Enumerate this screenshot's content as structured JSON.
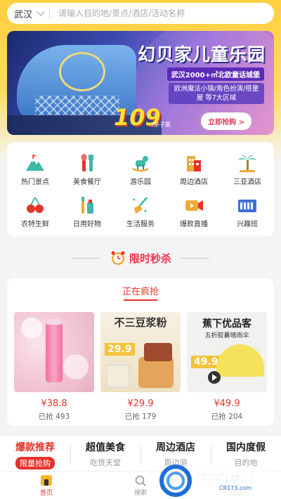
{
  "search": {
    "city": "武汉",
    "placeholder": "请输入目的地/景点/酒店/活动名称"
  },
  "banner": {
    "title": "幻贝家儿童乐园",
    "sub1": "武汉2000+㎡北欧童话城堡",
    "sub2": "欧洲魔法小镇/角色扮演/搭童屋 等7大区域",
    "price": "109",
    "unit": "/亲子票",
    "button": "立即抢购 >"
  },
  "categories": [
    {
      "label": "热门景点",
      "icon": "mountain-icon"
    },
    {
      "label": "美食餐厅",
      "icon": "cutlery-icon"
    },
    {
      "label": "游乐园",
      "icon": "rocking-horse-icon"
    },
    {
      "label": "周边酒店",
      "icon": "hotel-icon"
    },
    {
      "label": "三亚酒店",
      "icon": "palm-tree-icon"
    },
    {
      "label": "农特生鲜",
      "icon": "cherry-icon"
    },
    {
      "label": "日用好物",
      "icon": "toothbrush-icon"
    },
    {
      "label": "生活服务",
      "icon": "broom-icon"
    },
    {
      "label": "爆款直播",
      "icon": "video-camera-icon"
    },
    {
      "label": "兴趣班",
      "icon": "keyboard-icon"
    }
  ],
  "flash": {
    "title": "限时秒杀",
    "active_tab": "正在疯抢",
    "products": [
      {
        "price": "¥38.8",
        "sold": "已抢 493",
        "name": "pink-lotion"
      },
      {
        "price": "¥29.9",
        "sold": "已抢 179",
        "name": "soy-milk",
        "img_text": "不三豆浆粉",
        "img_price": "29.9"
      },
      {
        "price": "¥49.9",
        "sold": "已抢 204",
        "name": "umbrella",
        "img_text1": "蕉下优品客",
        "img_text2": "五折胶囊晴雨伞",
        "img_price": "49.9"
      }
    ]
  },
  "tabs": [
    {
      "title": "爆款推荐",
      "sub": "限量抢购"
    },
    {
      "title": "超值美食",
      "sub": "吃货天堂"
    },
    {
      "title": "周边酒店",
      "sub": "周边游"
    },
    {
      "title": "国内度假",
      "sub": "目的地"
    }
  ],
  "nav": [
    {
      "label": "首页",
      "icon": "home-icon"
    },
    {
      "label": "搜索",
      "icon": "search-icon"
    },
    {
      "label": "我的",
      "icon": "user-icon"
    }
  ],
  "watermark": {
    "text1": "西西软件园",
    "text2": "CR173.com"
  },
  "colors": {
    "accent": "#e6332a",
    "top_bg": "#ffcf3f"
  }
}
